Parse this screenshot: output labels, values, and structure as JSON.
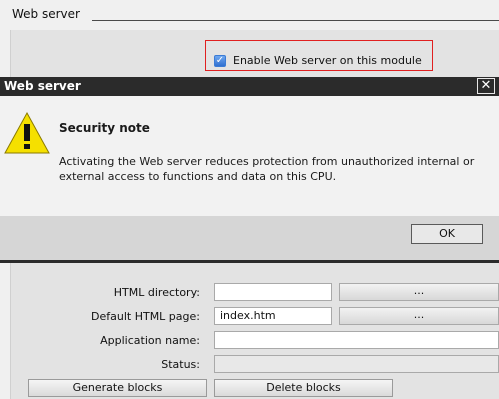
{
  "section": {
    "title": "Web server"
  },
  "enable_option": {
    "label": "Enable Web server on this module",
    "checked": true
  },
  "dialog": {
    "title": "Web server",
    "close_glyph": "✕",
    "heading": "Security note",
    "message": "Activating the Web server reduces protection from unauthorized internal or external access to functions and data on this CPU.",
    "ok_label": "OK"
  },
  "form": {
    "html_directory": {
      "label": "HTML directory:",
      "value": "",
      "browse_label": "..."
    },
    "default_page": {
      "label": "Default HTML page:",
      "value": "index.htm",
      "browse_label": "..."
    },
    "application_name": {
      "label": "Application name:",
      "value": ""
    },
    "status": {
      "label": "Status:",
      "value": ""
    }
  },
  "actions": {
    "generate_label": "Generate blocks",
    "delete_label": "Delete blocks"
  },
  "colors": {
    "titlebar": "#2b2b2b",
    "highlight_border": "#e02020",
    "warning_yellow": "#f5e000"
  }
}
